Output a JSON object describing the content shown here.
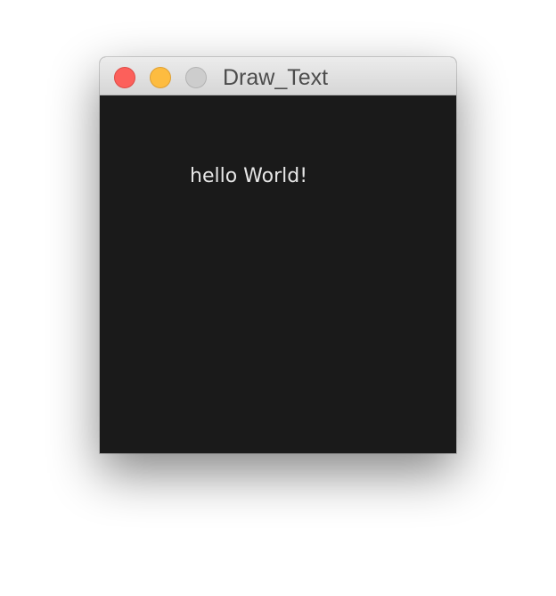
{
  "window": {
    "title": "Draw_Text"
  },
  "canvas": {
    "text": "hello World!",
    "background_color": "#1a1a1a",
    "text_color": "#e6e6e6"
  },
  "controls": {
    "close_icon": "close-icon",
    "minimize_icon": "minimize-icon",
    "zoom_icon": "zoom-icon",
    "close_color": "#fc605b",
    "minimize_color": "#fdbc40",
    "zoom_color": "#cdcdcd"
  }
}
